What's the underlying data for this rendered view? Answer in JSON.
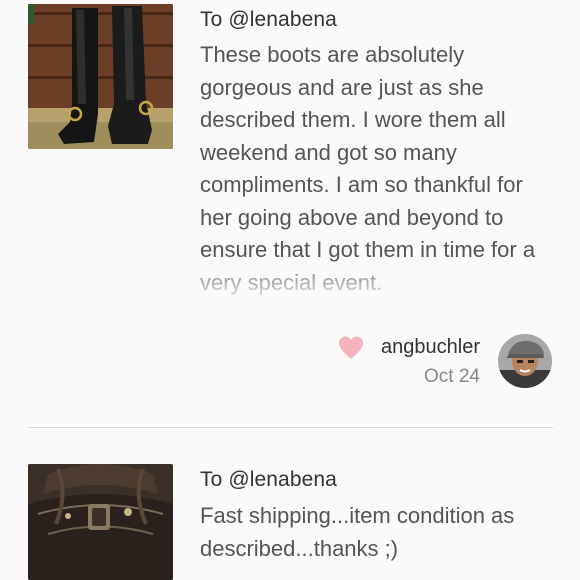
{
  "reviews": [
    {
      "to": "To @lenabena",
      "text": "These boots are absolutely gorgeous and are just as she described them. I wore them all weekend and got so many compliments. I am so thankful for her going above and beyond to ensure that I got them in time for a very special event.",
      "reviewer": "angbuchler",
      "date": "Oct 24",
      "icon": "heart-icon",
      "heart_color": "#f7b3bd"
    },
    {
      "to": "To @lenabena",
      "text": "Fast shipping...item condition as described...thanks ;)"
    }
  ]
}
